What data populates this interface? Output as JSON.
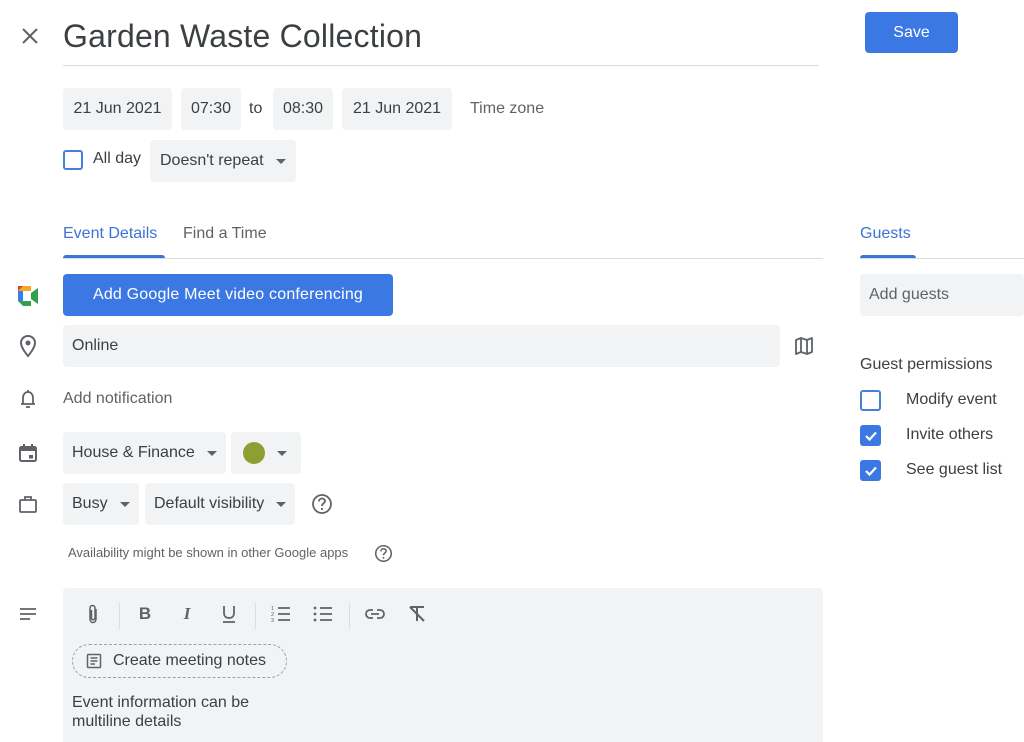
{
  "header": {
    "title": "Garden Waste Collection",
    "save_label": "Save",
    "close_icon": "close-icon"
  },
  "datetime": {
    "start_date": "21 Jun 2021",
    "start_time": "07:30",
    "to_label": "to",
    "end_time": "08:30",
    "end_date": "21 Jun 2021",
    "timezone_label": "Time zone"
  },
  "options": {
    "all_day_label": "All day",
    "all_day_checked": false,
    "repeat_value": "Doesn't repeat"
  },
  "tabs": {
    "items": [
      {
        "label": "Event Details",
        "active": true
      },
      {
        "label": "Find a Time",
        "active": false
      }
    ]
  },
  "details": {
    "meet_button_label": "Add Google Meet video conferencing",
    "location_value": "Online",
    "notification_label": "Add notification",
    "calendar_value": "House & Finance",
    "event_color": "#8f9e32",
    "availability_value": "Busy",
    "visibility_value": "Default visibility",
    "availability_note": "Availability might be shown in other Google apps"
  },
  "description": {
    "toolbar": [
      "attachment-icon",
      "bold-icon",
      "italic-icon",
      "underline-icon",
      "numbered-list-icon",
      "bulleted-list-icon",
      "link-icon",
      "remove-formatting-icon"
    ],
    "notes_button_label": "Create meeting notes",
    "text_line1": "Event information can be",
    "text_line2": "multiline details"
  },
  "guests": {
    "tab_label": "Guests",
    "input_placeholder": "Add guests",
    "permissions_title": "Guest permissions",
    "permissions": [
      {
        "label": "Modify event",
        "checked": false
      },
      {
        "label": "Invite others",
        "checked": true
      },
      {
        "label": "See guest list",
        "checked": true
      }
    ]
  },
  "colors": {
    "accent": "#3c78e3",
    "tab_active": "#3b73d6",
    "field_bg": "#f1f3f4"
  }
}
